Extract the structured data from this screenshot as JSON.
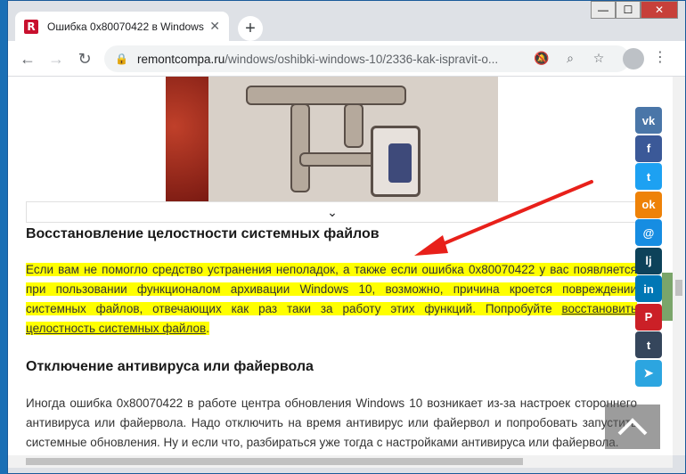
{
  "browser": {
    "tab": {
      "favicon_letter": "R",
      "title": "Ошибка 0x80070422 в Windows",
      "close": "✕"
    },
    "new_tab": "+",
    "window_controls": {
      "minimize": "—",
      "maximize": "☐",
      "close": "✕"
    },
    "nav": {
      "back": "←",
      "forward": "→",
      "reload": "↻"
    },
    "address": {
      "lock": "🔒",
      "host": "remontcompa.ru",
      "path": "/windows/oshibki-windows-10/2336-kak-ispravit-o..."
    },
    "icons": [
      "bell-muted-icon",
      "zoom-icon",
      "star-icon",
      "profile-icon",
      "menu-icon"
    ]
  },
  "article": {
    "collapse_chevron": "⌄",
    "section1": {
      "heading": "Восстановление целостности системных файлов",
      "text": "Если вам не помогло средство устранения неполадок, а также если ошибка 0x80070422 у вас появляется при пользовании функционалом архивации Windows 10, возможно, причина кроется повреждении системных файлов, отвечающих как раз таки за работу этих функций. Попробуйте ",
      "link": "восстановить целостность системных файлов",
      "tail": "."
    },
    "section2": {
      "heading": "Отключение антивируса или файервола",
      "text": "Иногда ошибка 0x80070422 в работе центра обновления Windows 10 возникает из-за настроек стороннего антивируса или файервола. Надо отключить на время антивирус или файервол и попробовать запустить системные обновления. Ну и если что, разбираться уже тогда с настройками антивируса или файервола."
    }
  },
  "share": [
    {
      "name": "vk",
      "label": "vk",
      "color": "#4a76a8"
    },
    {
      "name": "facebook",
      "label": "f",
      "color": "#3b5998"
    },
    {
      "name": "twitter",
      "label": "t",
      "color": "#1da1f2"
    },
    {
      "name": "odnoklassniki",
      "label": "ok",
      "color": "#ee8208"
    },
    {
      "name": "moimir",
      "label": "@",
      "color": "#168de2"
    },
    {
      "name": "livejournal",
      "label": "lj",
      "color": "#0d425a"
    },
    {
      "name": "linkedin",
      "label": "in",
      "color": "#0077b5"
    },
    {
      "name": "pinterest",
      "label": "P",
      "color": "#cb2027"
    },
    {
      "name": "tumblr",
      "label": "t",
      "color": "#35465c"
    },
    {
      "name": "telegram",
      "label": "➤",
      "color": "#2ca5e0"
    }
  ],
  "to_top": "^"
}
